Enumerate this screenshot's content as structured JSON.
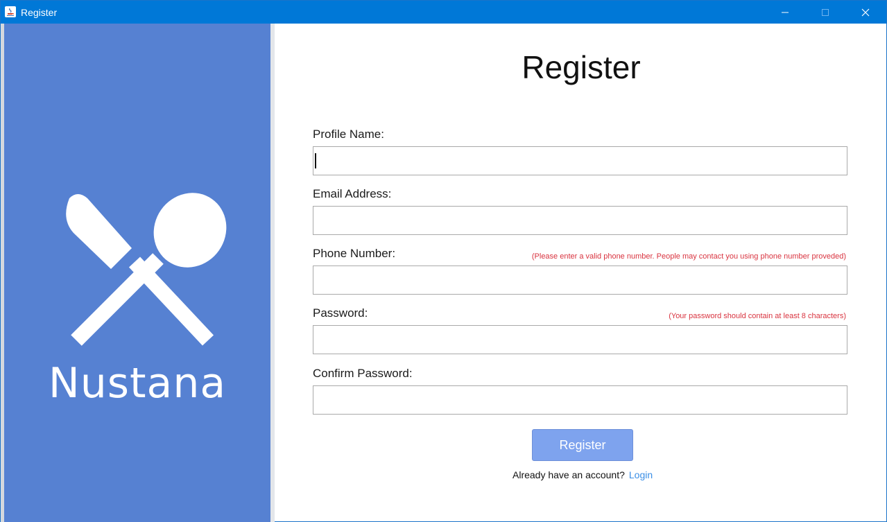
{
  "window": {
    "title": "Register",
    "titlebar_color": "#0078d7",
    "controls": [
      "minimize-icon",
      "maximize-icon",
      "close-icon"
    ]
  },
  "brand": {
    "name": "Nustana",
    "logo_icon": "knife-spoon-icon",
    "panel_color": "#5681d2"
  },
  "form": {
    "title": "Register",
    "fields": [
      {
        "label": "Profile Name:",
        "value": "",
        "hint": ""
      },
      {
        "label": "Email Address:",
        "value": "",
        "hint": ""
      },
      {
        "label": "Phone Number:",
        "value": "",
        "hint": "(Please enter a valid phone number. People may contact you using phone number proveded)"
      },
      {
        "label": "Password:",
        "value": "",
        "hint": "(Your password should contain at least 8 characters)"
      },
      {
        "label": "Confirm Password:",
        "value": "",
        "hint": ""
      }
    ],
    "submit_label": "Register",
    "already_text": "Already have an account?",
    "login_link": "Login",
    "hint_color": "#d9333f",
    "button_color": "#7ea3ee",
    "link_color": "#3a8ee6"
  }
}
